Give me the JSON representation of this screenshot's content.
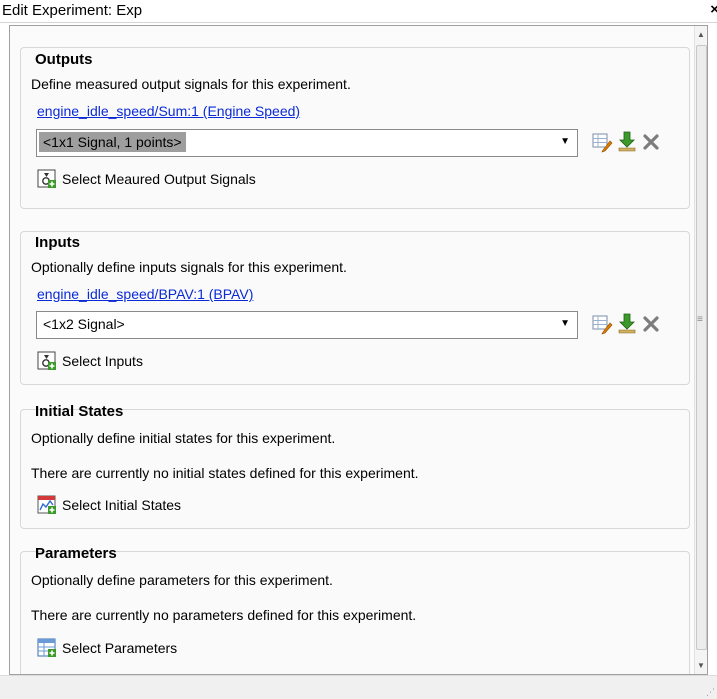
{
  "window": {
    "title": "Edit Experiment: Exp",
    "close_glyph": "×"
  },
  "outputs": {
    "title": "Outputs",
    "description": "Define measured output signals for this experiment.",
    "signal_link": "engine_idle_speed/Sum:1 (Engine Speed)",
    "selected_value": "<1x1 Signal, 1 points>",
    "select_button": "Select Meaured Output Signals"
  },
  "inputs": {
    "title": "Inputs",
    "description": "Optionally define inputs signals for this experiment.",
    "signal_link": "engine_idle_speed/BPAV:1 (BPAV)",
    "selected_value": "<1x2 Signal>",
    "select_button": "Select Inputs"
  },
  "initial_states": {
    "title": "Initial States",
    "description": "Optionally define initial states for this experiment.",
    "status": "There are currently no initial states defined for this experiment.",
    "select_button": "Select Initial States"
  },
  "parameters": {
    "title": "Parameters",
    "description": "Optionally define parameters for this experiment.",
    "status": "There are currently no parameters defined for this experiment.",
    "select_button": "Select Parameters"
  },
  "icons": {
    "edit": "edit-signal-icon",
    "import": "import-signal-icon",
    "delete": "delete-signal-icon",
    "select_signals": "select-signals-icon",
    "select_states": "select-states-icon",
    "select_params": "select-parameters-icon"
  },
  "colors": {
    "link": "#0a2ad6",
    "selection": "#9e9e9e",
    "icon_green": "#3c9a2a",
    "icon_orange": "#e07b00"
  }
}
